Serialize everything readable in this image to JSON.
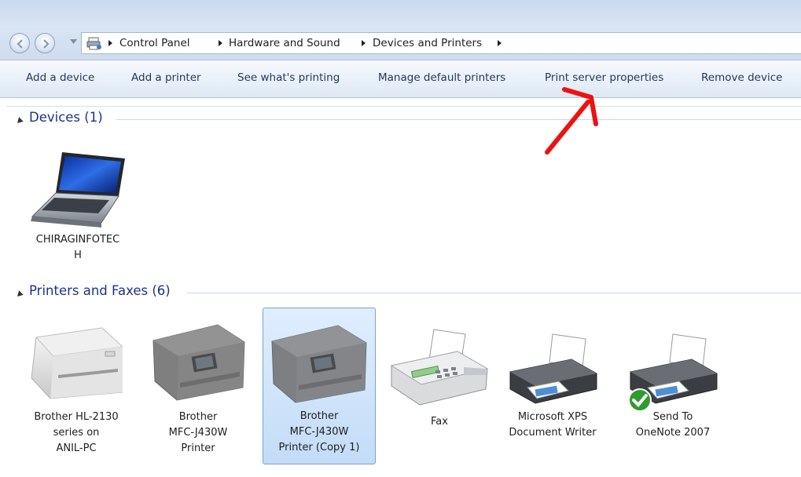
{
  "breadcrumb": [
    "Control Panel",
    "Hardware and Sound",
    "Devices and Printers"
  ],
  "toolbar": [
    "Add a device",
    "Add a printer",
    "See what's printing",
    "Manage default printers",
    "Print server properties",
    "Remove device"
  ],
  "devices_group": {
    "title": "Devices (1)",
    "items": [
      {
        "label_lines": [
          "CHIRAGINFOTEC",
          "H"
        ],
        "icon": "laptop-icon"
      }
    ]
  },
  "printers_group": {
    "title": "Printers and Faxes (6)",
    "items": [
      {
        "label_lines": [
          "Brother HL-2130",
          "series on",
          "ANIL-PC"
        ],
        "icon": "laser-printer-icon"
      },
      {
        "label_lines": [
          "Brother",
          "MFC-J430W",
          "Printer"
        ],
        "icon": "multifunction-printer-icon"
      },
      {
        "label_lines": [
          "Brother",
          "MFC-J430W",
          "Printer (Copy 1)"
        ],
        "icon": "multifunction-printer-icon",
        "selected": true
      },
      {
        "label_lines": [
          "Fax"
        ],
        "icon": "fax-icon"
      },
      {
        "label_lines": [
          "Microsoft XPS",
          "Document Writer"
        ],
        "icon": "printer-icon"
      },
      {
        "label_lines": [
          "Send To",
          "OneNote 2007"
        ],
        "icon": "printer-icon",
        "default_badge": true
      }
    ]
  },
  "colors": {
    "accent_text": "#1e3287",
    "command_text": "#1e395b",
    "annotation_arrow": "#ee1111",
    "selection": "#c3dcf7"
  }
}
